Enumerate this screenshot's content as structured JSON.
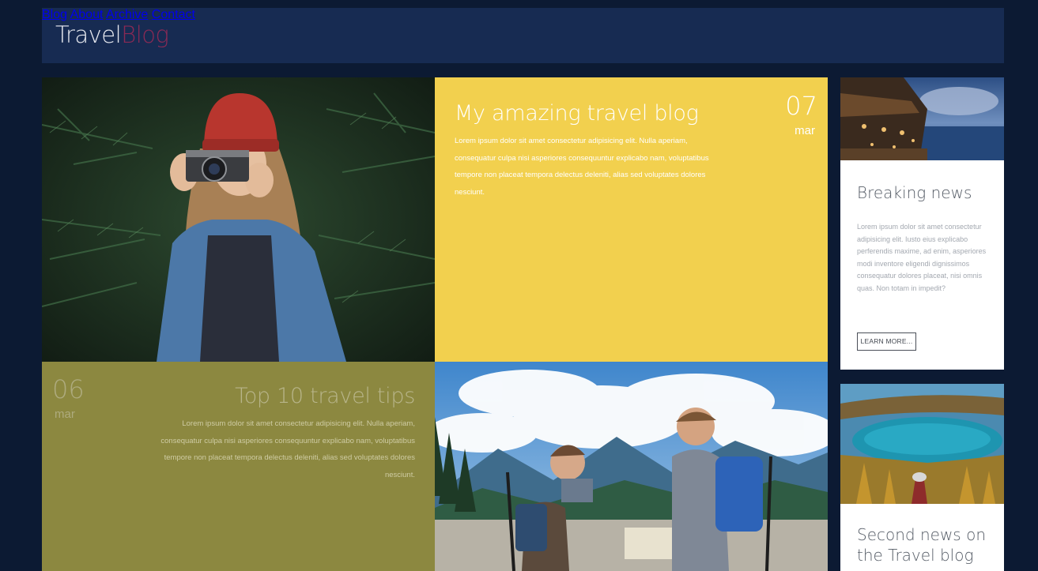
{
  "header": {
    "logo_part1": "Travel",
    "logo_part2": "Blog",
    "nav": [
      {
        "label": "Blog"
      },
      {
        "label": "About"
      },
      {
        "label": "Archive"
      },
      {
        "label": "Contact"
      }
    ]
  },
  "posts": [
    {
      "title": "My amazing travel blog",
      "day": "07",
      "month": "mar",
      "body": "Lorem ipsum dolor sit amet consectetur adipisicing elit. Nulla aperiam, consequatur culpa nisi asperiores consequuntur explicabo nam, voluptatibus tempore non placeat tempora delectus deleniti, alias sed voluptates dolores nesciunt."
    },
    {
      "title": "Top 10 travel tips",
      "day": "06",
      "month": "mar",
      "body": "Lorem ipsum dolor sit amet consectetur adipisicing elit. Nulla aperiam, consequatur culpa nisi asperiores consequuntur explicabo nam, voluptatibus tempore non placeat tempora delectus deleniti, alias sed voluptates dolores nesciunt."
    }
  ],
  "sidebar": {
    "card1": {
      "title": "Breaking news",
      "body": "Lorem ipsum dolor sit amet consectetur adipisicing elit. Iusto eius explicabo perferendis maxime, ad enim, asperiores modi inventore eligendi dignissimos consequatur dolores placeat, nisi omnis quas. Non totam in impedit?",
      "button": "LEARN MORE..."
    },
    "card2": {
      "title": "Second news on the Travel blog"
    }
  },
  "colors": {
    "page_bg": "#0c1a33",
    "header_bg": "#172b52",
    "logo_accent": "#8a2a55",
    "post1_bg": "#f2d04e",
    "post2_bg": "#8c8840"
  }
}
